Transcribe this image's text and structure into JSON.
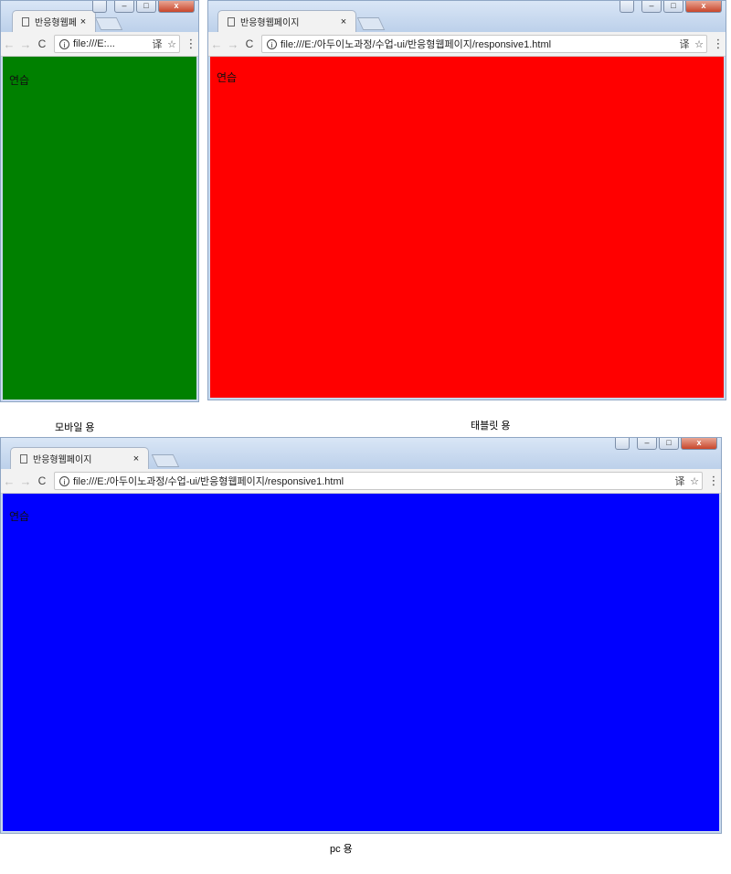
{
  "windows": {
    "mobile": {
      "tab_title": "반응형웹페",
      "url": "file:///E:...",
      "content_text": "연습",
      "background": "#008000",
      "caption": "모바일 용"
    },
    "tablet": {
      "tab_title": "반응형웹페이지",
      "url": "file:///E:/아두이노과정/수업-ui/반응형웹페이지/responsive1.html",
      "content_text": "연습",
      "background": "#ff0000",
      "caption": "태블릿 용"
    },
    "pc": {
      "tab_title": "반응형웹페이지",
      "url": "file:///E:/아두이노과정/수업-ui/반응형웹페이지/responsive1.html",
      "content_text": "연습",
      "background": "#0000ff",
      "caption": "pc 용"
    }
  },
  "icons": {
    "back": "←",
    "forward": "→",
    "reload": "C",
    "info": "i",
    "translate": "译",
    "star": "☆",
    "menu": "⋮",
    "close": "×",
    "minimize": "–",
    "maximize": "□",
    "window_close": "x"
  }
}
